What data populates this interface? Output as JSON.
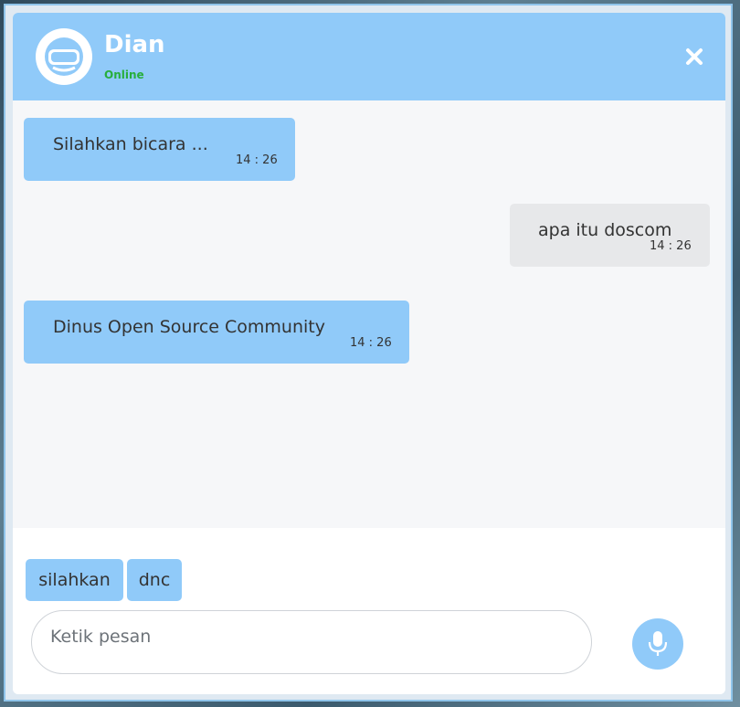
{
  "header": {
    "name": "Dian",
    "status": "Online",
    "avatar_icon": "vr-headset-icon",
    "close_icon": "close-icon"
  },
  "messages": [
    {
      "sender": "bot",
      "text": "Silahkan bicara ...",
      "time": "14 : 26"
    },
    {
      "sender": "user",
      "text": "apa itu doscom",
      "time": "14 : 26"
    },
    {
      "sender": "bot",
      "text": "Dinus Open Source Community",
      "time": "14 : 26"
    }
  ],
  "suggestions": [
    "silahkan",
    "dnc"
  ],
  "composer": {
    "placeholder": "Ketik pesan",
    "value": "",
    "mic_icon": "microphone-icon"
  },
  "colors": {
    "accent": "#90caf9",
    "online": "#27ae3c",
    "user_bubble": "#e7e8ea",
    "chat_bg": "#f6f7f9"
  }
}
